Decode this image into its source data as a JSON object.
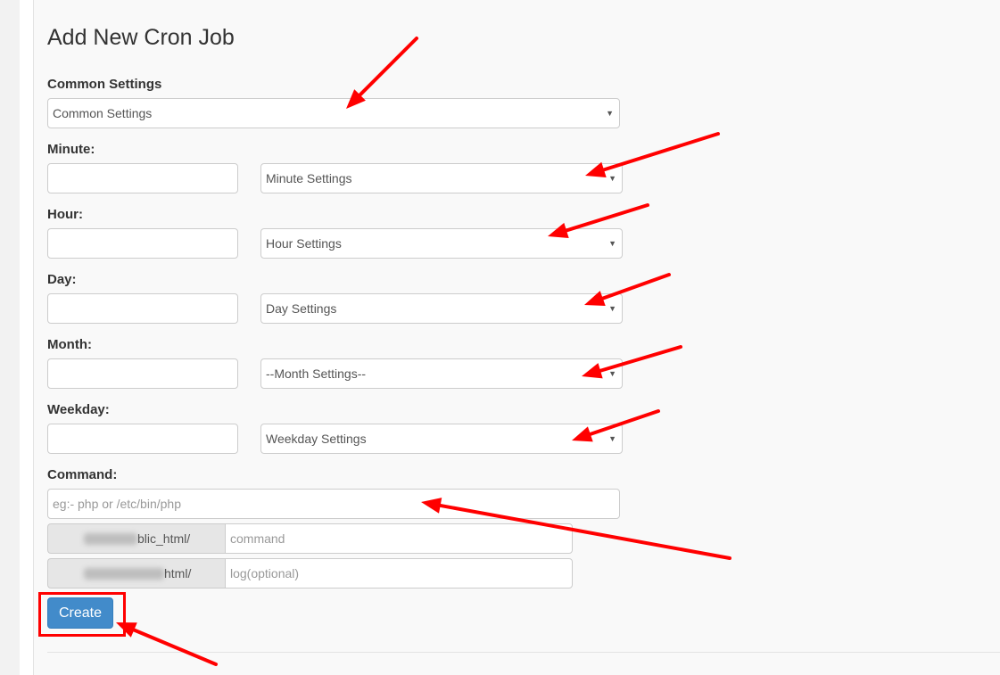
{
  "page": {
    "title": "Add New Cron Job"
  },
  "form": {
    "common": {
      "label": "Common Settings",
      "selected": "Common Settings"
    },
    "rows": [
      {
        "key": "minute",
        "label": "Minute:",
        "value": "",
        "select": "Minute Settings"
      },
      {
        "key": "hour",
        "label": "Hour:",
        "value": "",
        "select": "Hour Settings"
      },
      {
        "key": "day",
        "label": "Day:",
        "value": "",
        "select": "Day Settings"
      },
      {
        "key": "month",
        "label": "Month:",
        "value": "",
        "select": "--Month Settings--"
      },
      {
        "key": "weekday",
        "label": "Weekday:",
        "value": "",
        "select": "Weekday Settings"
      }
    ],
    "command": {
      "label": "Command:",
      "placeholder": "eg:- php or /etc/bin/php",
      "path_addon": "blic_html/",
      "path_placeholder": "command",
      "log_addon": "html/",
      "log_placeholder": "log(optional)"
    },
    "submit_label": "Create"
  },
  "annotation": {
    "color": "#ff0000"
  },
  "theme": {
    "primary": "#428bca"
  }
}
